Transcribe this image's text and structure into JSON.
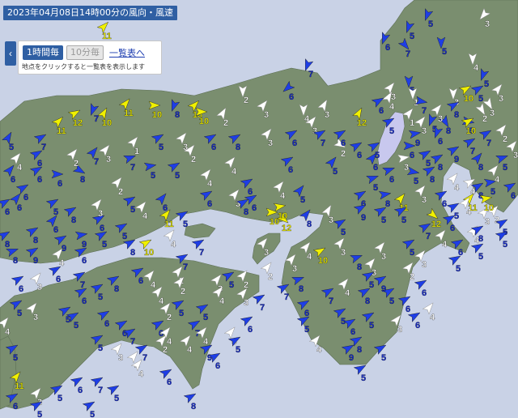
{
  "title": "2023年04月08日14時00分の風向・風速",
  "controls": {
    "back_icon": "chevron-left-icon",
    "hourly_label": "1時間毎",
    "tenmin_label": "10分毎",
    "list_link": "一覧表へ",
    "hint": "地点をクリックすると一覧表を表示します"
  },
  "colors": {
    "sea": "#c9d2e6",
    "land": "#7a8e6f",
    "lake": "#c8c8ee",
    "arrow_white": "#ffffff",
    "arrow_blue": "#1e3ee6",
    "arrow_yellow": "#f0f000",
    "label_white": "#ffffff",
    "label_blue": "#1a2fd0",
    "label_yellow": "#e8e800"
  },
  "stations": [
    {
      "v": "11",
      "c": "y",
      "d": 45
    },
    {
      "v": "5",
      "c": "b",
      "d": 200
    },
    {
      "v": "3",
      "c": "w",
      "d": 220
    },
    {
      "v": "5",
      "c": "b",
      "d": 200
    },
    {
      "v": "7",
      "c": "b",
      "d": 140
    },
    {
      "v": "5",
      "c": "b",
      "d": 180
    },
    {
      "v": "6",
      "c": "b",
      "d": 200
    },
    {
      "v": "7",
      "c": "b",
      "d": 200
    },
    {
      "v": "4",
      "c": "w",
      "d": 180
    },
    {
      "v": "5",
      "c": "b",
      "d": 200
    },
    {
      "v": "5",
      "c": "b",
      "d": 180
    },
    {
      "v": "1",
      "c": "w",
      "d": 180
    },
    {
      "v": "3",
      "c": "w",
      "d": 180
    },
    {
      "v": "6",
      "c": "b",
      "d": 230
    },
    {
      "v": "2",
      "c": "w",
      "d": 180
    },
    {
      "v": "8",
      "c": "b",
      "d": 200
    },
    {
      "v": "11",
      "c": "y",
      "d": 45
    },
    {
      "v": "12",
      "c": "y",
      "d": 60
    },
    {
      "v": "10",
      "c": "y",
      "d": 30
    },
    {
      "v": "7",
      "c": "b",
      "d": 200
    },
    {
      "v": "11",
      "c": "y",
      "d": 40
    },
    {
      "v": "10",
      "c": "y",
      "d": 90
    },
    {
      "v": "13",
      "c": "y",
      "d": 45
    },
    {
      "v": "10",
      "c": "y",
      "d": 90
    },
    {
      "v": "5",
      "c": "b",
      "d": 30
    },
    {
      "v": "7",
      "c": "b",
      "d": 60
    },
    {
      "v": "2",
      "c": "w",
      "d": 30
    },
    {
      "v": "3",
      "c": "w",
      "d": 40
    },
    {
      "v": "3",
      "c": "w",
      "d": 30
    },
    {
      "v": "3",
      "c": "w",
      "d": 40
    },
    {
      "v": "6",
      "c": "b",
      "d": 60
    },
    {
      "v": "4",
      "c": "w",
      "d": 30
    },
    {
      "v": "3",
      "c": "w",
      "d": 40
    },
    {
      "v": "4",
      "c": "w",
      "d": 180
    },
    {
      "v": "12",
      "c": "y",
      "d": 30
    },
    {
      "v": "7",
      "c": "b",
      "d": 100
    },
    {
      "v": "5",
      "c": "b",
      "d": 200
    },
    {
      "v": "8",
      "c": "b",
      "d": 150
    },
    {
      "v": "6",
      "c": "b",
      "d": 200
    },
    {
      "v": "6",
      "c": "b",
      "d": 100
    },
    {
      "v": "10",
      "c": "y",
      "d": 60
    },
    {
      "v": "2",
      "c": "w",
      "d": 150
    },
    {
      "v": "3",
      "c": "w",
      "d": 150
    },
    {
      "v": "9",
      "c": "b",
      "d": 80
    },
    {
      "v": "6",
      "c": "b",
      "d": 90
    },
    {
      "v": "3",
      "c": "w",
      "d": 80
    },
    {
      "v": "5",
      "c": "b",
      "d": 100
    },
    {
      "v": "2",
      "c": "w",
      "d": 120
    },
    {
      "v": "6",
      "c": "b",
      "d": 60
    },
    {
      "v": "6",
      "c": "b",
      "d": 40
    },
    {
      "v": "6",
      "c": "b",
      "d": 90
    },
    {
      "v": "8",
      "c": "b",
      "d": 120
    },
    {
      "v": "7",
      "c": "b",
      "d": 40
    },
    {
      "v": "7",
      "c": "b",
      "d": 70
    },
    {
      "v": "2",
      "c": "w",
      "d": 40
    },
    {
      "v": "2",
      "c": "w",
      "d": 40
    },
    {
      "v": "5",
      "c": "b",
      "d": 80
    },
    {
      "v": "5",
      "c": "b",
      "d": 60
    },
    {
      "v": "4",
      "c": "w",
      "d": 40
    },
    {
      "v": "4",
      "c": "w",
      "d": 40
    },
    {
      "v": "6",
      "c": "b",
      "d": 60
    },
    {
      "v": "5",
      "c": "b",
      "d": 40
    },
    {
      "v": "6",
      "c": "b",
      "d": 40
    },
    {
      "v": "5",
      "c": "b",
      "d": 70
    },
    {
      "v": "6",
      "c": "b",
      "d": 70
    },
    {
      "v": "8",
      "c": "b",
      "d": 60
    },
    {
      "v": "4",
      "c": "w",
      "d": 40
    },
    {
      "v": "8",
      "c": "b",
      "d": 40
    },
    {
      "v": "5",
      "c": "b",
      "d": 70
    },
    {
      "v": "5",
      "c": "b",
      "d": 80
    },
    {
      "v": "4",
      "c": "w",
      "d": 60
    },
    {
      "v": "4",
      "c": "w",
      "d": 40
    },
    {
      "v": "6",
      "c": "b",
      "d": 40
    },
    {
      "v": "5",
      "c": "b",
      "d": 60
    },
    {
      "v": "6",
      "c": "b",
      "d": 40
    },
    {
      "v": "8",
      "c": "b",
      "d": 60
    },
    {
      "v": "6",
      "c": "b",
      "d": 60
    },
    {
      "v": "3",
      "c": "w",
      "d": 40
    },
    {
      "v": "5",
      "c": "b",
      "d": 60
    },
    {
      "v": "4",
      "c": "w",
      "d": 40
    },
    {
      "v": "6",
      "c": "b",
      "d": 40
    },
    {
      "v": "11",
      "c": "y",
      "d": 40
    },
    {
      "v": "5",
      "c": "b",
      "d": 60
    },
    {
      "v": "6",
      "c": "b",
      "d": 60
    },
    {
      "v": "3",
      "c": "w",
      "d": 40
    },
    {
      "v": "8",
      "c": "b",
      "d": 60
    },
    {
      "v": "10",
      "c": "y",
      "d": 90
    },
    {
      "v": "12",
      "c": "y",
      "d": 130
    },
    {
      "v": "10",
      "c": "y",
      "d": 80
    },
    {
      "v": "6",
      "c": "b",
      "d": 60
    },
    {
      "v": "6",
      "c": "b",
      "d": 60
    },
    {
      "v": "4",
      "c": "w",
      "d": 40
    },
    {
      "v": "5",
      "c": "b",
      "d": 40
    },
    {
      "v": "8",
      "c": "b",
      "d": 40
    },
    {
      "v": "3",
      "c": "w",
      "d": 30
    },
    {
      "v": "5",
      "c": "b",
      "d": 60
    },
    {
      "v": "6",
      "c": "b",
      "d": 60
    },
    {
      "v": "9",
      "c": "b",
      "d": 60
    },
    {
      "v": "5",
      "c": "b",
      "d": 60
    },
    {
      "v": "8",
      "c": "b",
      "d": 80
    },
    {
      "v": "11",
      "c": "y",
      "d": 40
    },
    {
      "v": "5",
      "c": "b",
      "d": 60
    },
    {
      "v": "3",
      "c": "w",
      "d": 40
    },
    {
      "v": "6",
      "c": "b",
      "d": 60
    },
    {
      "v": "11",
      "c": "y",
      "d": 40
    },
    {
      "v": "8",
      "c": "b",
      "d": 60
    },
    {
      "v": "2",
      "c": "w",
      "d": 40
    },
    {
      "v": "5",
      "c": "b",
      "d": 60
    },
    {
      "v": "4",
      "c": "w",
      "d": 40
    },
    {
      "v": "6",
      "c": "b",
      "d": 60
    },
    {
      "v": "4",
      "c": "w",
      "d": 40
    },
    {
      "v": "5",
      "c": "b",
      "d": 60
    },
    {
      "v": "8",
      "c": "b",
      "d": 70
    },
    {
      "v": "9",
      "c": "b",
      "d": 60
    },
    {
      "v": "4",
      "c": "w",
      "d": 40
    },
    {
      "v": "6",
      "c": "b",
      "d": 60
    },
    {
      "v": "7",
      "c": "b",
      "d": 60
    },
    {
      "v": "9",
      "c": "b",
      "d": 80
    },
    {
      "v": "5",
      "c": "b",
      "d": 60
    },
    {
      "v": "5",
      "c": "b",
      "d": 60
    },
    {
      "v": "8",
      "c": "b",
      "d": 60
    },
    {
      "v": "10",
      "c": "y",
      "d": 60
    },
    {
      "v": "4",
      "c": "w",
      "d": 40
    },
    {
      "v": "7",
      "c": "b",
      "d": 60
    },
    {
      "v": "3",
      "c": "w",
      "d": 40
    },
    {
      "v": "5",
      "c": "b",
      "d": 60
    },
    {
      "v": "2",
      "c": "w",
      "d": 40
    },
    {
      "v": "3",
      "c": "w",
      "d": 40
    },
    {
      "v": "2",
      "c": "w",
      "d": 40
    },
    {
      "v": "3",
      "c": "w",
      "d": 40
    },
    {
      "v": "8",
      "c": "b",
      "d": 70
    },
    {
      "v": "4",
      "c": "w",
      "d": 40
    },
    {
      "v": "10",
      "c": "y",
      "d": 60
    },
    {
      "v": "3",
      "c": "w",
      "d": 40
    },
    {
      "v": "8",
      "c": "b",
      "d": 70
    },
    {
      "v": "3",
      "c": "w",
      "d": 40
    },
    {
      "v": "3",
      "c": "w",
      "d": 40
    },
    {
      "v": "5",
      "c": "b",
      "d": 60
    },
    {
      "v": "5",
      "c": "b",
      "d": 60
    },
    {
      "v": "6",
      "c": "b",
      "d": 60
    },
    {
      "v": "3",
      "c": "w",
      "d": 40
    },
    {
      "v": "6",
      "c": "b",
      "d": 60
    },
    {
      "v": "5",
      "c": "b",
      "d": 60
    },
    {
      "v": "8",
      "c": "b",
      "d": 60
    },
    {
      "v": "6",
      "c": "b",
      "d": 60
    },
    {
      "v": "4",
      "c": "w",
      "d": 40
    },
    {
      "v": "2",
      "c": "w",
      "d": 40
    },
    {
      "v": "2",
      "c": "w",
      "d": 40
    },
    {
      "v": "7",
      "c": "b",
      "d": 60
    },
    {
      "v": "4",
      "c": "w",
      "d": 40
    },
    {
      "v": "2",
      "c": "w",
      "d": 40
    },
    {
      "v": "5",
      "c": "b",
      "d": 60
    },
    {
      "v": "5",
      "c": "b",
      "d": 60
    },
    {
      "v": "7",
      "c": "b",
      "d": 60
    },
    {
      "v": "4",
      "c": "w",
      "d": 40
    },
    {
      "v": "6",
      "c": "b",
      "d": 60
    },
    {
      "v": "4",
      "c": "w",
      "d": 40
    },
    {
      "v": "9",
      "c": "b",
      "d": 60
    },
    {
      "v": "6",
      "c": "b",
      "d": 60
    },
    {
      "v": "5",
      "c": "b",
      "d": 60
    },
    {
      "v": "5",
      "c": "b",
      "d": 60
    },
    {
      "v": "3",
      "c": "w",
      "d": 40
    },
    {
      "v": "5",
      "c": "b",
      "d": 60
    },
    {
      "v": "5",
      "c": "b",
      "d": 60
    },
    {
      "v": "6",
      "c": "b",
      "d": 60
    },
    {
      "v": "6",
      "c": "b",
      "d": 60
    },
    {
      "v": "7",
      "c": "b",
      "d": 60
    },
    {
      "v": "6",
      "c": "b",
      "d": 60
    },
    {
      "v": "2",
      "c": "w",
      "d": 40
    },
    {
      "v": "4",
      "c": "w",
      "d": 40
    },
    {
      "v": "4",
      "c": "w",
      "d": 40
    },
    {
      "v": "6",
      "c": "b",
      "d": 60
    },
    {
      "v": "8",
      "c": "b",
      "d": 60
    },
    {
      "v": "5",
      "c": "b",
      "d": 60
    },
    {
      "v": "11",
      "c": "y",
      "d": 40
    },
    {
      "v": "3",
      "c": "w",
      "d": 40
    },
    {
      "v": "5",
      "c": "b",
      "d": 60
    },
    {
      "v": "6",
      "c": "b",
      "d": 60
    },
    {
      "v": "7",
      "c": "b",
      "d": 60
    },
    {
      "v": "5",
      "c": "b",
      "d": 60
    },
    {
      "v": "5",
      "c": "b",
      "d": 60
    },
    {
      "v": "5",
      "c": "b",
      "d": 60
    },
    {
      "v": "6",
      "c": "b",
      "d": 60
    },
    {
      "v": "6",
      "c": "b",
      "d": 60
    },
    {
      "v": "7",
      "c": "b",
      "d": 60
    },
    {
      "v": "4",
      "c": "w",
      "d": 40
    },
    {
      "v": "8",
      "c": "b",
      "d": 60
    },
    {
      "v": "5",
      "c": "b",
      "d": 60
    },
    {
      "v": "6",
      "c": "b",
      "d": 60
    },
    {
      "v": "6",
      "c": "b",
      "d": 60
    },
    {
      "v": "4",
      "c": "w",
      "d": 40
    },
    {
      "v": "8",
      "c": "b",
      "d": 60
    },
    {
      "v": "5",
      "c": "b",
      "d": 60
    },
    {
      "v": "9",
      "c": "b",
      "d": 60
    },
    {
      "v": "5",
      "c": "b",
      "d": 60
    },
    {
      "v": "8",
      "c": "b",
      "d": 60
    },
    {
      "v": "8",
      "c": "b",
      "d": 60
    },
    {
      "v": "9",
      "c": "b",
      "d": 60
    },
    {
      "v": "6",
      "c": "b",
      "d": 60
    },
    {
      "v": "6",
      "c": "b",
      "d": 60
    },
    {
      "v": "6",
      "c": "b",
      "d": 60
    },
    {
      "v": "4",
      "c": "w",
      "d": 40
    },
    {
      "v": "6",
      "c": "b",
      "d": 60
    },
    {
      "v": "2",
      "c": "w",
      "d": 40
    },
    {
      "v": "3",
      "c": "w",
      "d": 40
    },
    {
      "v": "1",
      "c": "w",
      "d": 40
    },
    {
      "v": "5",
      "c": "b",
      "d": 60
    },
    {
      "v": "3",
      "c": "w",
      "d": 40
    },
    {
      "v": "6",
      "c": "b",
      "d": 60
    },
    {
      "v": "8",
      "c": "b",
      "d": 60
    },
    {
      "v": "3",
      "c": "w",
      "d": 40
    },
    {
      "v": "6",
      "c": "b",
      "d": 60
    },
    {
      "v": "7",
      "c": "b",
      "d": 60
    },
    {
      "v": "6",
      "c": "b",
      "d": 60
    },
    {
      "v": "6",
      "c": "b",
      "d": 60
    },
    {
      "v": "5",
      "c": "b",
      "d": 60
    },
    {
      "v": "5",
      "c": "b",
      "d": 60
    },
    {
      "v": "8",
      "c": "b",
      "d": 60
    },
    {
      "v": "9",
      "c": "b",
      "d": 60
    },
    {
      "v": "7",
      "c": "b",
      "d": 60
    },
    {
      "v": "7",
      "c": "b",
      "d": 60
    },
    {
      "v": "2",
      "c": "w",
      "d": 40
    },
    {
      "v": "3",
      "c": "w",
      "d": 40
    },
    {
      "v": "6",
      "c": "b",
      "d": 60
    },
    {
      "v": "4",
      "c": "w",
      "d": 40
    },
    {
      "v": "3",
      "c": "w",
      "d": 40
    },
    {
      "v": "4",
      "c": "w",
      "d": 40
    },
    {
      "v": "5",
      "c": "b",
      "d": 60
    },
    {
      "v": "3",
      "c": "w",
      "d": 40
    },
    {
      "v": "7",
      "c": "b",
      "d": 60
    },
    {
      "v": "4",
      "c": "w",
      "d": 40
    },
    {
      "v": "4",
      "c": "w",
      "d": 40
    },
    {
      "v": "4",
      "c": "w",
      "d": 40
    },
    {
      "v": "3",
      "c": "w",
      "d": 40
    },
    {
      "v": "7",
      "c": "b",
      "d": 60
    },
    {
      "v": "7",
      "c": "b",
      "d": 60
    },
    {
      "v": "5",
      "c": "b",
      "d": 60
    },
    {
      "v": "5",
      "c": "b",
      "d": 60
    },
    {
      "v": "6",
      "c": "b",
      "d": 60
    },
    {
      "v": "5",
      "c": "b",
      "d": 60
    },
    {
      "v": "3",
      "c": "w",
      "d": 40
    },
    {
      "v": "6",
      "c": "b",
      "d": 60
    },
    {
      "v": "4",
      "c": "w",
      "d": 40
    },
    {
      "v": "3",
      "c": "w",
      "d": 40
    },
    {
      "v": "5",
      "c": "b",
      "d": 60
    },
    {
      "v": "9",
      "c": "b",
      "d": 60
    },
    {
      "v": "2",
      "c": "w",
      "d": 40
    },
    {
      "v": "7",
      "c": "b",
      "d": 60
    },
    {
      "v": "12",
      "c": "y",
      "d": 130
    },
    {
      "v": "10",
      "c": "y",
      "d": 80
    },
    {
      "v": "5",
      "c": "b",
      "d": 60
    },
    {
      "v": "8",
      "c": "b",
      "d": 60
    },
    {
      "v": "6",
      "c": "b",
      "d": 60
    },
    {
      "v": "5",
      "c": "b",
      "d": 60
    },
    {
      "v": "5",
      "c": "b",
      "d": 60
    },
    {
      "v": "1",
      "c": "w",
      "d": 40
    },
    {
      "v": "3",
      "c": "w",
      "d": 40
    },
    {
      "v": "3",
      "c": "w",
      "d": 40
    },
    {
      "v": "8",
      "c": "b",
      "d": 60
    },
    {
      "v": "10",
      "c": "y",
      "d": 60
    },
    {
      "v": "5",
      "c": "b",
      "d": 60
    },
    {
      "v": "3",
      "c": "w",
      "d": 40
    }
  ]
}
